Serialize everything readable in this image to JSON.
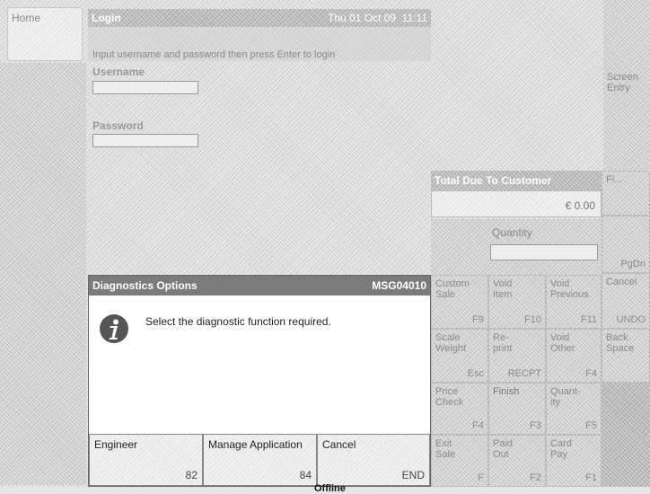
{
  "home_label": "Home",
  "login": {
    "title": "Login",
    "datetime": "Thu 01 Oct 09  11:11",
    "instruction": "Input username and password then press Enter to login",
    "username_label": "Username",
    "password_label": "Password"
  },
  "right_panel": {
    "screen_entry": "Screen\nEntry",
    "total_due": "Total Due To Customer",
    "amount": "€ 0.00",
    "quantity_label": "Quantity",
    "keys": [
      {
        "label": "Custom\nSale",
        "key": "F9"
      },
      {
        "label": "Void\nItem",
        "key": "F10"
      },
      {
        "label": "Void\nPrevious",
        "key": "F11"
      },
      {
        "label": "Scale\nWeight",
        "key": "Esc"
      },
      {
        "label": "Re-\nprint",
        "key": "RECPT"
      },
      {
        "label": "Void\nOther",
        "key": "F4"
      },
      {
        "label": "Price\nCheck",
        "key": "F4"
      },
      {
        "label": "Finish",
        "key": "F3"
      },
      {
        "label": "Quant-\nity",
        "key": "F5"
      },
      {
        "label": "Exit\nSale",
        "key": "F"
      },
      {
        "label": "Paid\nOut",
        "key": "F2"
      },
      {
        "label": "Card\nPay",
        "key": "F1"
      }
    ],
    "side_labels": [
      "Fi...",
      "PgDn",
      "Cancel",
      "UNDO",
      "Back\nSpace"
    ]
  },
  "dialog": {
    "title": "Diagnostics Options",
    "code": "MSG04010",
    "message": "Select the diagnostic function required.",
    "icon": "info-icon",
    "buttons": [
      {
        "label": "Engineer",
        "key": "82"
      },
      {
        "label": "Manage Application",
        "key": "84"
      },
      {
        "label": "Cancel",
        "key": "END"
      }
    ]
  },
  "status": "Offline"
}
